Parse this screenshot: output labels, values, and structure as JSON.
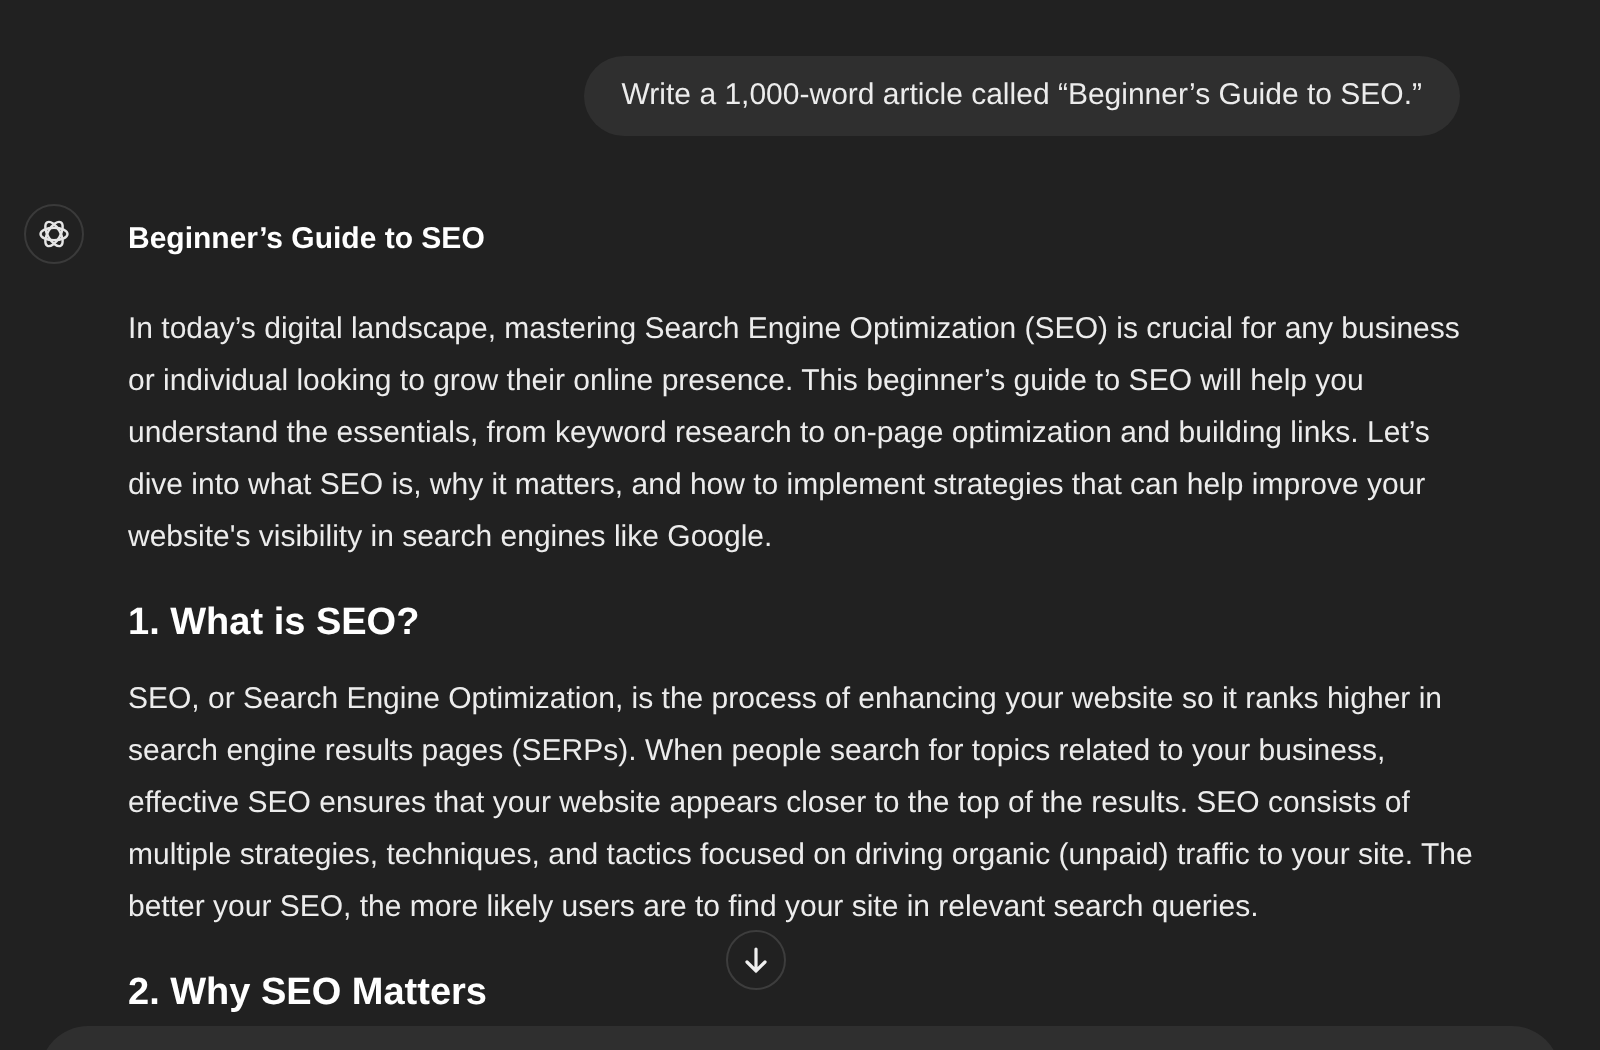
{
  "user_message": "Write a 1,000-word article called “Beginner’s Guide to SEO.”",
  "assistant": {
    "title": "Beginner’s Guide to SEO",
    "blocks": [
      {
        "kind": "paragraph",
        "text": "In today’s digital landscape, mastering Search Engine Optimization (SEO) is crucial for any business or individual looking to grow their online presence. This beginner’s guide to SEO will help you understand the essentials, from keyword research to on-page optimization and building links. Let’s dive into what SEO is, why it matters, and how to implement strategies that can help improve your website's visibility in search engines like Google."
      },
      {
        "kind": "heading",
        "text": "1. What is SEO?"
      },
      {
        "kind": "paragraph",
        "text": "SEO, or Search Engine Optimization, is the process of enhancing your website so it ranks higher in search engine results pages (SERPs). When people search for topics related to your business, effective SEO ensures that your website appears closer to the top of the results. SEO consists of multiple strategies, techniques, and tactics focused on driving organic (unpaid) traffic to your site. The better your SEO, the more likely users are to find your site in relevant search queries."
      },
      {
        "kind": "heading",
        "text": "2. Why SEO Matters"
      }
    ]
  }
}
